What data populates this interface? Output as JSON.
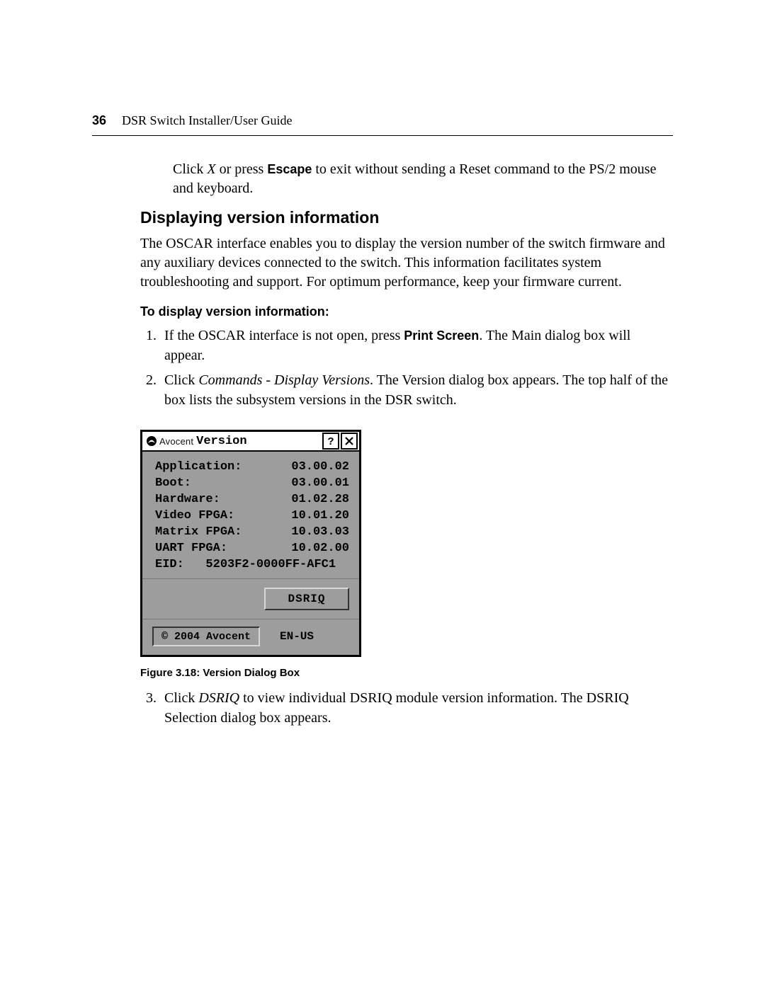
{
  "header": {
    "page_number": "36",
    "title": "DSR Switch Installer/User Guide"
  },
  "text": {
    "para_top_1": "Click ",
    "para_top_x": "X",
    "para_top_2": " or press ",
    "para_top_escape": "Escape",
    "para_top_3": " to exit without sending a Reset command to the PS/2 mouse and keyboard.",
    "heading": "Displaying version information",
    "intro": "The OSCAR interface enables you to display the version number of the switch firmware and any auxiliary devices connected to the switch. This information facilitates system troubleshooting and support. For optimum performance, keep your firmware current.",
    "subheading": "To display version information:",
    "step1_a": "If the OSCAR interface is not open, press ",
    "step1_b": "Print Screen",
    "step1_c": ". The Main dialog box will appear.",
    "step2_a": "Click ",
    "step2_b": "Commands - Display Versions",
    "step2_c": ". The Version dialog box appears. The top half of the box lists the subsystem versions in the DSR switch.",
    "figcap": "Figure 3.18: Version Dialog Box",
    "step3_a": "Click ",
    "step3_b": "DSRIQ",
    "step3_c": " to view individual DSRIQ module version information. The DSRIQ Selection dialog box appears."
  },
  "dialog": {
    "brand": "Avocent",
    "title": "Version",
    "help": "?",
    "close": "X",
    "rows": [
      {
        "label": "Application:",
        "value": "03.00.02"
      },
      {
        "label": "Boot:",
        "value": "03.00.01"
      },
      {
        "label": "Hardware:",
        "value": "01.02.28"
      },
      {
        "label": "Video FPGA:",
        "value": "10.01.20"
      },
      {
        "label": "Matrix FPGA:",
        "value": "10.03.03"
      },
      {
        "label": "UART FPGA:",
        "value": "10.02.00"
      }
    ],
    "eid_label": "EID:",
    "eid_value": "5203F2-0000FF-AFC1",
    "button_dsriq_pre": "DSRI",
    "button_dsriq_u": "Q",
    "copyright": "© 2004 Avocent",
    "locale": "EN-US"
  }
}
